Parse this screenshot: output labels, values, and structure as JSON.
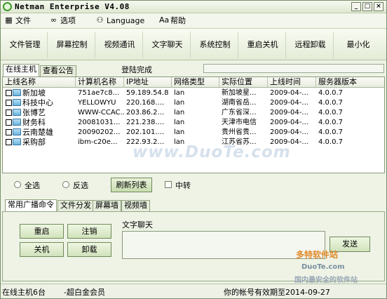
{
  "window": {
    "title": "Netman Enterprise V4.08",
    "controls": [
      "_",
      "□",
      "×"
    ]
  },
  "menu": [
    {
      "label": "文件",
      "icon": "folder-icon"
    },
    {
      "label": "选项",
      "icon": "glasses-icon"
    },
    {
      "label": "Language",
      "icon": "language-icon"
    },
    {
      "label": "帮助",
      "icon": "help-icon"
    }
  ],
  "toolbar": [
    "文件管理",
    "屏幕控制",
    "视频通讯",
    "文字聊天",
    "系统控制",
    "重启关机",
    "远程卸载",
    "最小化"
  ],
  "top_tabs": [
    "在线主机",
    "查看公告"
  ],
  "login_status": "登陆完成",
  "host_table": {
    "columns": [
      "上线名称",
      "计算机名称",
      "IP地址",
      "网络类型",
      "实际位置",
      "上线时间",
      "服务器版本"
    ],
    "rows": [
      [
        "新加坡",
        "751ae7c8...",
        "59.189.54.8",
        "lan",
        "新加坡星...",
        "2009-04-...",
        "4.0.0.7"
      ],
      [
        "科技中心",
        "YELLOWYU",
        "220.168....",
        "lan",
        "湖南省岳...",
        "2009-04-...",
        "4.0.0.7"
      ],
      [
        "张博艺",
        "WWW-CCAC...",
        "203.86.2...",
        "lan",
        "广东省深...",
        "2009-04-...",
        "4.0.0.7"
      ],
      [
        "财务科",
        "20081031...",
        "221.238....",
        "lan",
        "天津市电信",
        "2009-04-...",
        "4.0.0.7"
      ],
      [
        "云南楚雄",
        "20090202...",
        "202.101....",
        "lan",
        "贵州省贵...",
        "2009-04-...",
        "4.0.0.7"
      ],
      [
        "采购部",
        "ibm-c20e...",
        "222.93.2...",
        "lan",
        "江苏省苏...",
        "2009-04-...",
        "4.0.0.7"
      ]
    ],
    "watermark": "www.DuoTe.com"
  },
  "selection": {
    "select_all": "全选",
    "invert": "反选",
    "refresh": "刷新列表",
    "relay": "中转"
  },
  "bottom_tabs": [
    "常用广播命令",
    "文件分发",
    "屏幕墙",
    "视频墙"
  ],
  "commands": {
    "restart": "重启",
    "logout": "注销",
    "shutdown": "关机",
    "uninstall": "卸载",
    "chat_label": "文字聊天",
    "send": "发送"
  },
  "site_watermark": {
    "brand": "多特软件站",
    "domain": "DuoTe.com",
    "slogan": "国内最安全的软件站"
  },
  "status": {
    "online": "在线主机6台",
    "member": "-超白金会员",
    "expiry": "你的帐号有效期至2014-09-27"
  },
  "colors": {
    "background": "#eef3e6",
    "border": "#8a9a7a",
    "button_gradient_top": "#eef6e2",
    "button_gradient_bottom": "#d2e3bc",
    "watermark": "#b4c8dc"
  }
}
